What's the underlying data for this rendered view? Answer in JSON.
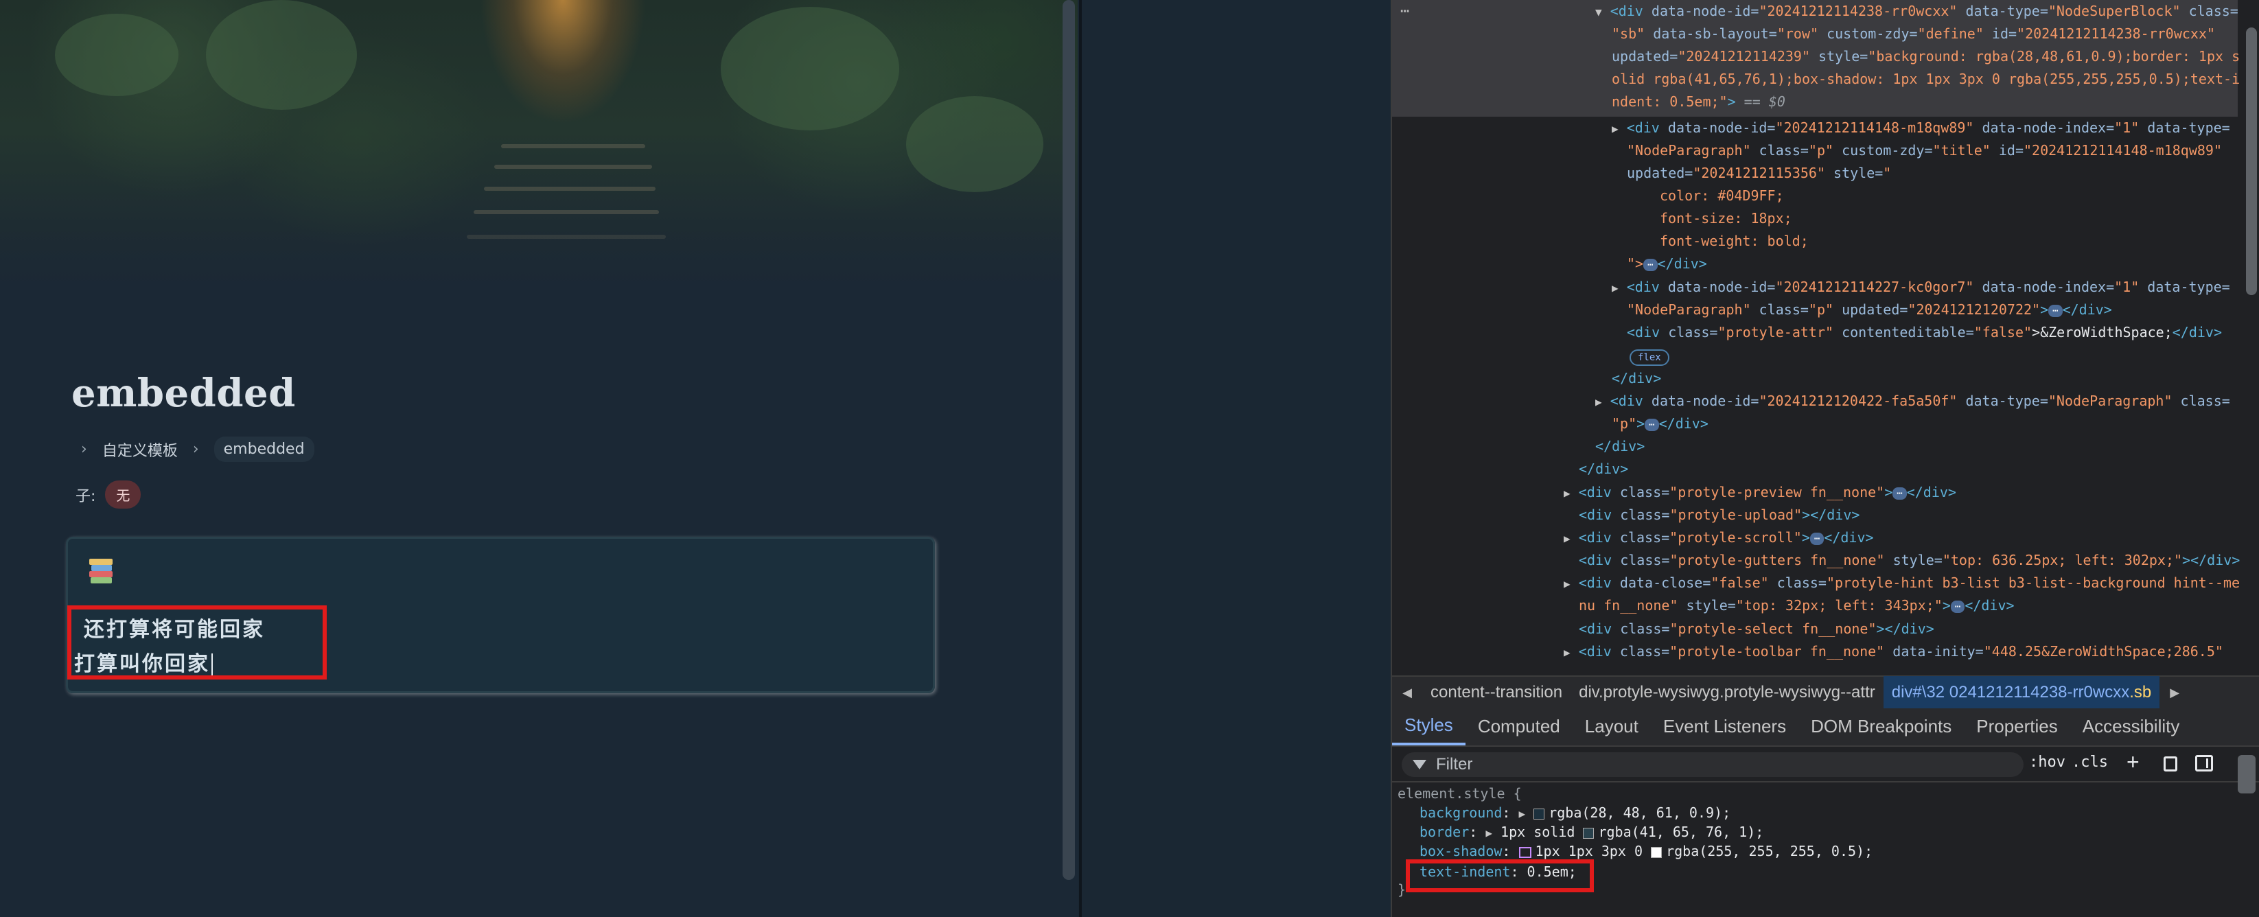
{
  "editor": {
    "title": "embedded",
    "breadcrumb": [
      "自定义模板",
      "embedded"
    ],
    "children_label": "子:",
    "children_badge": "无",
    "block_line1": "还打算将可能回家",
    "block_line2": "打算叫你回家"
  },
  "devtools": {
    "more": "⋯",
    "elements": {
      "l1_tag": "<div ",
      "l1_a1": "data-node-id=",
      "l1_v1": "\"20241212114238-rr0wcxx\"",
      "l1_a2": " data-type=",
      "l1_v2": "\"NodeSuperBlock\"",
      "l1_a3": " class=",
      "l2_v3": "\"sb\"",
      "l2_a4": " data-sb-layout=",
      "l2_v4": "\"row\"",
      "l2_a5": " custom-zdy=",
      "l2_v5": "\"define\"",
      "l2_a6": " id=",
      "l2_v6": "\"20241212114238-rr0wcxx\"",
      "l3_a7": "updated=",
      "l3_v7": "\"20241212114239\"",
      "l3_a8": " style=",
      "l3_v8": "\"background: rgba(28,48,61,0.9);border: 1px s",
      "l4_v8": "olid rgba(41,65,76,1);box-shadow: 1px 1px 3px 0 rgba(255,255,255,0.5);text-i",
      "l5_v8": "ndent: 0.5em;\"",
      "l5_tail": "> ",
      "l5_eq": "== $0",
      "l6_tag": "<div ",
      "l6_a1": "data-node-id=",
      "l6_v1": "\"20241212114148-m18qw89\"",
      "l6_a2": " data-node-index=",
      "l6_v2": "\"1\"",
      "l6_a3": " data-type=",
      "l7_v3": "\"NodeParagraph\"",
      "l7_a4": " class=",
      "l7_v4": "\"p\"",
      "l7_a5": " custom-zdy=",
      "l7_v5": "\"title\"",
      "l7_a6": " id=",
      "l7_v6": "\"20241212114148-m18qw89\"",
      "l8_a7": "updated=",
      "l8_v7": "\"20241212115356\"",
      "l8_a8": " style=",
      "l8_v8": "\"",
      "l9": "color: #04D9FF;",
      "l10": "font-size: 18px;",
      "l11": "font-weight: bold;",
      "l12_v": "\">",
      "l12_close": "</div>",
      "l13_tag": "<div ",
      "l13_a1": "data-node-id=",
      "l13_v1": "\"20241212114227-kc0gor7\"",
      "l13_a2": " data-node-index=",
      "l13_v2": "\"1\"",
      "l13_a3": " data-type=",
      "l14_v3": "\"NodeParagraph\"",
      "l14_a4": " class=",
      "l14_v4": "\"p\"",
      "l14_a5": " updated=",
      "l14_v5": "\"20241212120722\"",
      "l14_tail": ">",
      "l14_close": "</div>",
      "l15_tag": "<div ",
      "l15_a1": "class=",
      "l15_v1": "\"protyle-attr\"",
      "l15_a2": " contenteditable=",
      "l15_v2": "\"false\"",
      "l15_text": ">&ZeroWidthSpace;",
      "l15_close": "</div>",
      "l16_badge": "flex",
      "l17": "</div>",
      "l18_tag": "<div ",
      "l18_a1": "data-node-id=",
      "l18_v1": "\"20241212120422-fa5a50f\"",
      "l18_a2": " data-type=",
      "l18_v2": "\"NodeParagraph\"",
      "l18_a3": " class=",
      "l19_v3": "\"p\"",
      "l19_tail": ">",
      "l19_close": "</div>",
      "l20": "</div>",
      "l21": "</div>",
      "l22_tag": "<div ",
      "l22_a1": "class=",
      "l22_v1": "\"protyle-preview fn__none\"",
      "l22_tail": ">",
      "l22_close": "</div>",
      "l23_tag": "<div ",
      "l23_a1": "class=",
      "l23_v1": "\"protyle-upload\"",
      "l23_close": "></div>",
      "l24_tag": "<div ",
      "l24_a1": "class=",
      "l24_v1": "\"protyle-scroll\"",
      "l24_tail": ">",
      "l24_close": "</div>",
      "l25_tag": "<div ",
      "l25_a1": "class=",
      "l25_v1": "\"protyle-gutters fn__none\"",
      "l25_a2": " style=",
      "l25_v2": "\"top: 636.25px; left: 302px;\"",
      "l25_close": "></div>",
      "l26_tag": "<div ",
      "l26_a1": "data-close=",
      "l26_v1": "\"false\"",
      "l26_a2": " class=",
      "l26_v2": "\"protyle-hint b3-list b3-list--background hint--me",
      "l27_v2": "nu fn__none\"",
      "l27_a3": " style=",
      "l27_v3": "\"top: 32px; left: 343px;\"",
      "l27_tail": ">",
      "l27_close": "</div>",
      "l28_tag": "<div ",
      "l28_a1": "class=",
      "l28_v1": "\"protyle-select fn__none\"",
      "l28_close": "></div>",
      "l29_tag": "<div ",
      "l29_a1": "class=",
      "l29_v1": "\"protyle-toolbar fn__none\"",
      "l29_a2": " data-inity=",
      "l29_v2": "\"448.25&ZeroWidthSpace;286.5\"",
      "dots": "⋯"
    },
    "crumbs": [
      "content--transition",
      "div.protyle-wysiwyg.protyle-wysiwyg--attr"
    ],
    "crumb_active_prefix": "div#\\32 0241212114238-rr0wcxx",
    "crumb_active_suffix": ".sb",
    "tabs": [
      "Styles",
      "Computed",
      "Layout",
      "Event Listeners",
      "DOM Breakpoints",
      "Properties",
      "Accessibility"
    ],
    "filter_placeholder": "Filter",
    "hov": ":hov",
    "cls": ".cls",
    "plus": "+",
    "styles": {
      "selector": "element.style {",
      "p1_name": "background",
      "p1_val": "rgba(28, 48, 61, 0.9);",
      "p2_name": "border",
      "p2_val_a": "1px solid ",
      "p2_val_b": "rgba(41, 65, 76, 1);",
      "p3_name": "box-shadow",
      "p3_val_a": "1px 1px 3px 0 ",
      "p3_val_b": "rgba(255, 255, 255, 0.5);",
      "p4_name": "text-indent",
      "p4_val": "0.5em;",
      "close": "}",
      "swatch1": "#1c303d",
      "swatch2": "#29414c",
      "swatch3": "#ffffff"
    }
  }
}
